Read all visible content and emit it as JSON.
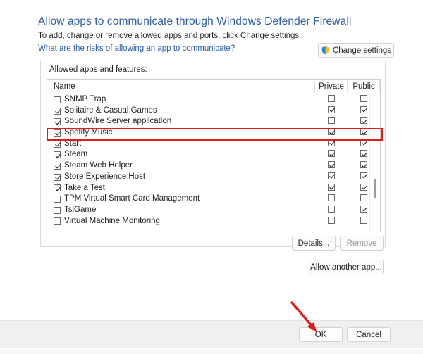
{
  "header": {
    "title": "Allow apps to communicate through Windows Defender Firewall",
    "subtitle": "To add, change or remove allowed apps and ports, click Change settings.",
    "risks_link": "What are the risks of allowing an app to communicate?",
    "change_settings_label": "Change settings",
    "shield_icon": "shield-icon"
  },
  "group": {
    "label": "Allowed apps and features:"
  },
  "table": {
    "columns": [
      "Name",
      "Private",
      "Public"
    ],
    "rows": [
      {
        "name": "SNMP Trap",
        "enabled": false,
        "private": false,
        "public": false,
        "highlighted": false
      },
      {
        "name": "Solitaire & Casual Games",
        "enabled": true,
        "private": true,
        "public": true,
        "highlighted": false
      },
      {
        "name": "SoundWire Server application",
        "enabled": true,
        "private": false,
        "public": true,
        "highlighted": false
      },
      {
        "name": "Spotify Music",
        "enabled": true,
        "private": true,
        "public": true,
        "highlighted": true
      },
      {
        "name": "Start",
        "enabled": true,
        "private": true,
        "public": true,
        "highlighted": false
      },
      {
        "name": "Steam",
        "enabled": true,
        "private": true,
        "public": true,
        "highlighted": false
      },
      {
        "name": "Steam Web Helper",
        "enabled": true,
        "private": true,
        "public": true,
        "highlighted": false
      },
      {
        "name": "Store Experience Host",
        "enabled": true,
        "private": true,
        "public": true,
        "highlighted": false
      },
      {
        "name": "Take a Test",
        "enabled": true,
        "private": true,
        "public": true,
        "highlighted": false
      },
      {
        "name": "TPM Virtual Smart Card Management",
        "enabled": false,
        "private": false,
        "public": false,
        "highlighted": false
      },
      {
        "name": "TslGame",
        "enabled": false,
        "private": false,
        "public": true,
        "highlighted": false
      },
      {
        "name": "Virtual Machine Monitoring",
        "enabled": false,
        "private": false,
        "public": false,
        "highlighted": false
      }
    ]
  },
  "actions": {
    "details_label": "Details...",
    "remove_label": "Remove",
    "allow_another_label": "Allow another app..."
  },
  "footer": {
    "ok_label": "OK",
    "cancel_label": "Cancel"
  },
  "annotations": {
    "highlight_color": "#e01b1b",
    "arrow_color": "#d42020",
    "highlight_target": "Spotify Music",
    "arrow_target": "OK"
  },
  "colors": {
    "title_blue": "#2f5c9e",
    "link_blue": "#2a60a8",
    "background": "#ffffff",
    "footer_gray": "#f0f0f0"
  }
}
